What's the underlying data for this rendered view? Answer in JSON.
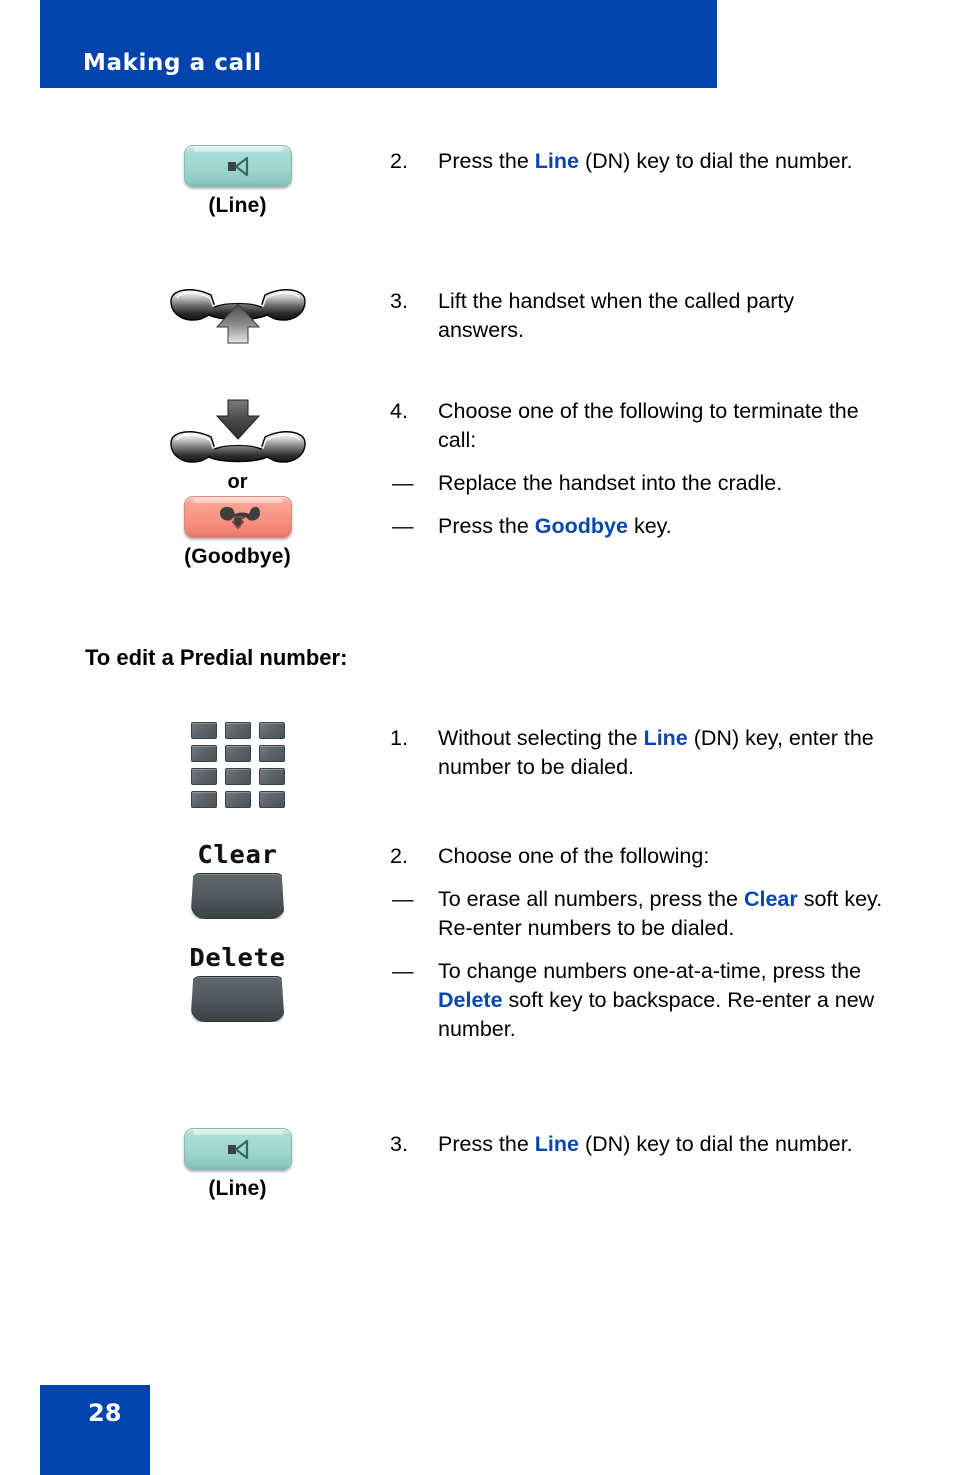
{
  "header": {
    "title": "Making a call",
    "bar_color": "#0344ac"
  },
  "accent_color": "#0a47ad",
  "keys": {
    "line_label": "(Line)",
    "goodbye_label": "(Goodbye)",
    "or_label": "or",
    "clear_softkey_text": "Clear",
    "delete_softkey_text": "Delete",
    "line_key_color": "#9fd6ce",
    "goodbye_key_color": "#f79383",
    "softkey_color": "#4c5357",
    "dialpad_key_color": "#5b6469"
  },
  "section1": {
    "steps": [
      {
        "num": "2.",
        "icon": "line-key-icon",
        "text_before": "Press the ",
        "keyword": "Line",
        "text_after": " (DN) key to dial the number.",
        "subitems": []
      },
      {
        "num": "3.",
        "icon": "handset-lift-icon",
        "text_before": "Lift the handset when the called party answers.",
        "keyword": "",
        "text_after": "",
        "subitems": []
      },
      {
        "num": "4.",
        "icon": "handset-replace-goodbye-icon",
        "text_before": "Choose one of the following to terminate the call:",
        "keyword": "",
        "text_after": "",
        "subitems": [
          {
            "dash": "—",
            "text_before": "Replace the handset into the cradle.",
            "keyword": "",
            "text_after": ""
          },
          {
            "dash": "—",
            "text_before": "Press the ",
            "keyword": "Goodbye",
            "text_after": " key."
          }
        ]
      }
    ]
  },
  "section2": {
    "heading": "To edit a Predial number:",
    "steps": [
      {
        "num": "1.",
        "icon": "dialpad-icon",
        "text_before": "Without selecting the ",
        "keyword": "Line",
        "text_after": " (DN) key, enter the number to be dialed.",
        "subitems": []
      },
      {
        "num": "2.",
        "icon": "clear-delete-softkeys-icon",
        "text_before": "Choose one of the following:",
        "keyword": "",
        "text_after": "",
        "subitems": [
          {
            "dash": "—",
            "text_before": "To erase all numbers, press the ",
            "keyword": "Clear",
            "text_after": " soft key. Re-enter numbers to be dialed."
          },
          {
            "dash": "—",
            "text_before": "To change numbers one-at-a-time, press the ",
            "keyword": "Delete",
            "text_after": " soft key to backspace. Re-enter a new number."
          }
        ]
      },
      {
        "num": "3.",
        "icon": "line-key-icon",
        "text_before": "Press the ",
        "keyword": "Line",
        "text_after": " (DN) key to dial the number.",
        "subitems": []
      }
    ]
  },
  "footer": {
    "page_number": "28",
    "box_color": "#0344ac"
  }
}
